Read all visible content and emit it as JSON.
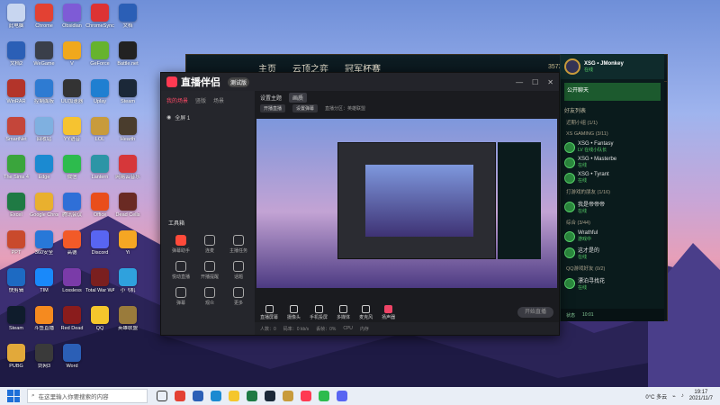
{
  "desktop": {
    "icons": [
      {
        "label": "此电脑",
        "color": "#c8d6f0"
      },
      {
        "label": "Chrome",
        "color": "#e34133"
      },
      {
        "label": "Obsidian",
        "color": "#7e5bd6"
      },
      {
        "label": "ChromeSync",
        "color": "#d33"
      },
      {
        "label": "文档",
        "color": "#2b5fb6"
      },
      {
        "label": "文档2",
        "color": "#2b5fb6"
      },
      {
        "label": "WeGame",
        "color": "#3a3f4a"
      },
      {
        "label": "V",
        "color": "#f0a81c"
      },
      {
        "label": "GeForce",
        "color": "#66b32e"
      },
      {
        "label": "Battle.net",
        "color": "#222"
      },
      {
        "label": "WinRAR",
        "color": "#b3342a"
      },
      {
        "label": "控制面板",
        "color": "#2e7bd2"
      },
      {
        "label": "UU加速器",
        "color": "#333"
      },
      {
        "label": "Uplay",
        "color": "#1f7fd1"
      },
      {
        "label": "Steam",
        "color": "#1b2838"
      },
      {
        "label": "SmartNet",
        "color": "#c4463a"
      },
      {
        "label": "回收站",
        "color": "#7fb0e0"
      },
      {
        "label": "YY语音",
        "color": "#f6c330"
      },
      {
        "label": "LOL",
        "color": "#c89b3c"
      },
      {
        "label": "Hearth",
        "color": "#4a3d2d"
      },
      {
        "label": "The Sims 4",
        "color": "#3aa53c"
      },
      {
        "label": "Edge",
        "color": "#1b8ad1"
      },
      {
        "label": "微信",
        "color": "#2dbb4d"
      },
      {
        "label": "Lantern",
        "color": "#2c95a6"
      },
      {
        "label": "网易云音乐",
        "color": "#d6373a"
      },
      {
        "label": "Excel",
        "color": "#1f7a44"
      },
      {
        "label": "Google Chrome",
        "color": "#e9b02e"
      },
      {
        "label": "腾讯会议",
        "color": "#2f6fd7"
      },
      {
        "label": "Office",
        "color": "#e94e1b"
      },
      {
        "label": "Dead Cells",
        "color": "#6a2a23"
      },
      {
        "label": "PPT",
        "color": "#c94a2c"
      },
      {
        "label": "360安全",
        "color": "#2878d8"
      },
      {
        "label": "高德",
        "color": "#f25a28"
      },
      {
        "label": "Discord",
        "color": "#5865f2"
      },
      {
        "label": "Yi",
        "color": "#f5a623"
      },
      {
        "label": "快剪辑",
        "color": "#1d6ac2"
      },
      {
        "label": "TIM",
        "color": "#1989fa"
      },
      {
        "label": "Lossless",
        "color": "#7a3ba8"
      },
      {
        "label": "Total War WARHAM",
        "color": "#7a1f1f"
      },
      {
        "label": "小飞机",
        "color": "#2fa1dd"
      },
      {
        "label": "Steam",
        "color": "#0f1c2c"
      },
      {
        "label": "斗鱼直播",
        "color": "#f58a1f"
      },
      {
        "label": "Red Dead",
        "color": "#8a1c1c"
      },
      {
        "label": "QQ",
        "color": "#f5c62c"
      },
      {
        "label": "英雄联盟",
        "color": "#9a7b3b"
      },
      {
        "label": "PUBG",
        "color": "#e2a93a"
      },
      {
        "label": "剑网3",
        "color": "#3a3a3a"
      },
      {
        "label": "Word",
        "color": "#2b5fb6"
      }
    ]
  },
  "streamer": {
    "logo": "直播伴侣",
    "badge": "测试版",
    "tabs": [
      "我的场景",
      "竖版",
      "场景"
    ],
    "scene_label": "全屏 1",
    "tools_title": "工具箱",
    "tools": [
      "弹幕助手",
      "连麦",
      "主播任务",
      "悦动直播",
      "开播提醒",
      "话题",
      "弹幕",
      "观众",
      "更多"
    ],
    "mainbar": {
      "title": "设置主题",
      "btn": "画质"
    },
    "sub": {
      "btn1": "开播直播",
      "btn2": "设置弹幕",
      "info": "直播分区：英雄联盟"
    },
    "bottom_buttons": [
      "直播屏幕",
      "摄像头",
      "手机投屏",
      "多媒体",
      "麦克风",
      "扬声器"
    ],
    "live_btn": "开始直播",
    "status": [
      "人数：0",
      "码率：0 kb/s",
      "丢帧：0%",
      "CPU",
      "内存"
    ]
  },
  "lol": {
    "nav": [
      "主页",
      "云顶之弈",
      "冠军杯赛"
    ],
    "coin": "3573",
    "friends": {
      "user": "XSG • JMonkey",
      "user_status": "在线",
      "banner": "公开聊天",
      "section": "好友列表",
      "groups": [
        "近期小组 (1/1)",
        "XS GAMING (3/11)",
        "打游戏的朋友 (1/16)",
        "综合 (3/44)",
        "QQ游戏好友 (0/2)"
      ],
      "items": [
        {
          "name": "XSG • Fantasy",
          "sub": "LV 在线小队长"
        },
        {
          "name": "XSG • Masterbe",
          "sub": "在线"
        },
        {
          "name": "XSG • Tyrant",
          "sub": "在线"
        },
        {
          "name": "我是帝帝帝",
          "sub": "在线"
        },
        {
          "name": "Wrathful",
          "sub": "游戏中"
        },
        {
          "name": "这才是的",
          "sub": "在线"
        },
        {
          "name": "漂泊寻找花",
          "sub": "在线"
        }
      ],
      "bottom": [
        "状态",
        "10:01"
      ]
    }
  },
  "taskbar": {
    "search_placeholder": "在这里输入你要搜索的内容",
    "weather": "0°C 多云",
    "time": "19:17",
    "date": "2021/11/7"
  }
}
